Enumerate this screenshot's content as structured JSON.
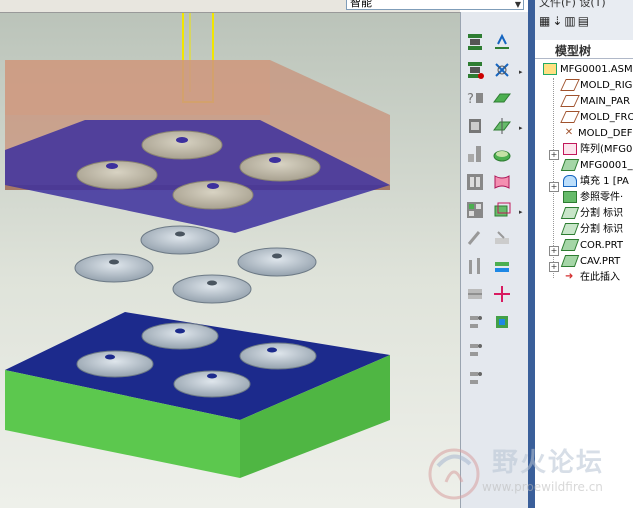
{
  "topbar": {
    "filter_value": "智能"
  },
  "tree": {
    "menu_label": "文件(F)   设(T)",
    "panel_title": "模型树",
    "items": [
      {
        "label": "MFG0001.ASM",
        "icon": "assembly-icon"
      },
      {
        "label": "MOLD_RIG",
        "icon": "datum-plane-icon"
      },
      {
        "label": "MAIN_PAR",
        "icon": "datum-plane-icon"
      },
      {
        "label": "MOLD_FRO",
        "icon": "datum-plane-icon"
      },
      {
        "label": "MOLD_DEF",
        "icon": "csys-icon"
      },
      {
        "label": "阵列(MFG0",
        "icon": "pattern-icon"
      },
      {
        "label": "MFG0001_",
        "icon": "part-icon"
      },
      {
        "label": "填充 1 [PA",
        "icon": "fill-icon"
      },
      {
        "label": "参照零件·",
        "icon": "reference-part-icon"
      },
      {
        "label": "分割 标识",
        "icon": "split-icon"
      },
      {
        "label": "分割 标识",
        "icon": "split-icon"
      },
      {
        "label": "COR.PRT",
        "icon": "part-icon"
      },
      {
        "label": "CAV.PRT",
        "icon": "part-icon"
      },
      {
        "label": "在此插入",
        "icon": "insert-here-icon"
      }
    ]
  },
  "watermark": {
    "title": "野火论坛",
    "url": "www.proewildfire.cn"
  },
  "colors": {
    "cavity": "#c8927a",
    "parting": "#3c2f9e",
    "core_top": "#1c2a8c",
    "core_side": "#5cc84e",
    "part": "#c9c2b0",
    "part_grey": "#b3bec8",
    "sprue": "#f2e600",
    "tree_bar": "#3a5f9a"
  }
}
